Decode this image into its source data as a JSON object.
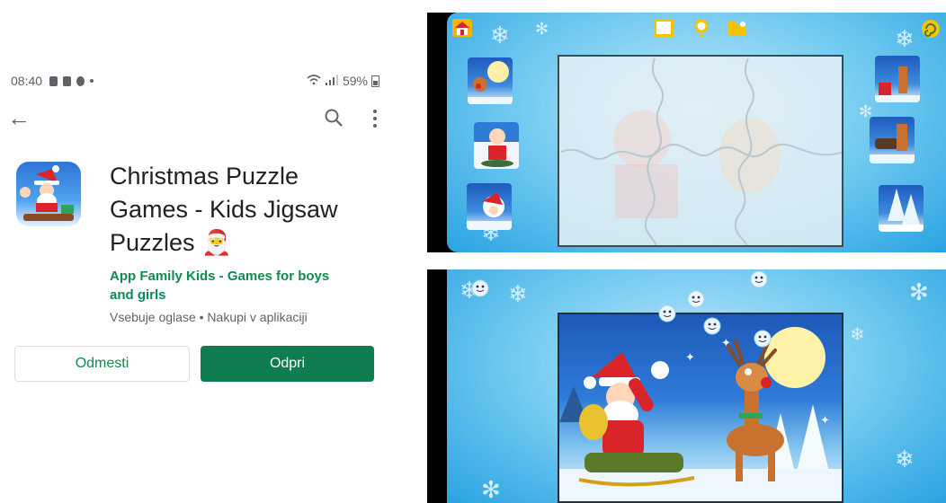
{
  "status": {
    "time": "08:40",
    "battery": "59%"
  },
  "app": {
    "title_lines": [
      "Christmas Puzzle",
      "Games - Kids Jigsaw",
      "Puzzles 🎅"
    ],
    "developer_lines": [
      "App Family Kids - Games for boys",
      "and girls"
    ],
    "meta": "Vsebuje oglase  •  Nakupi v aplikaciji",
    "uninstall_label": "Odmesti",
    "open_label": "Odpri"
  },
  "colors": {
    "accent": "#0f7d50",
    "accent_text": "#0f8a53",
    "sky": "#6cc7ef"
  },
  "icons": [
    "back-arrow-icon",
    "search-icon",
    "more-vert-icon",
    "home-icon",
    "frame-icon",
    "magnifier-icon",
    "folder-icon",
    "spiral-icon"
  ]
}
